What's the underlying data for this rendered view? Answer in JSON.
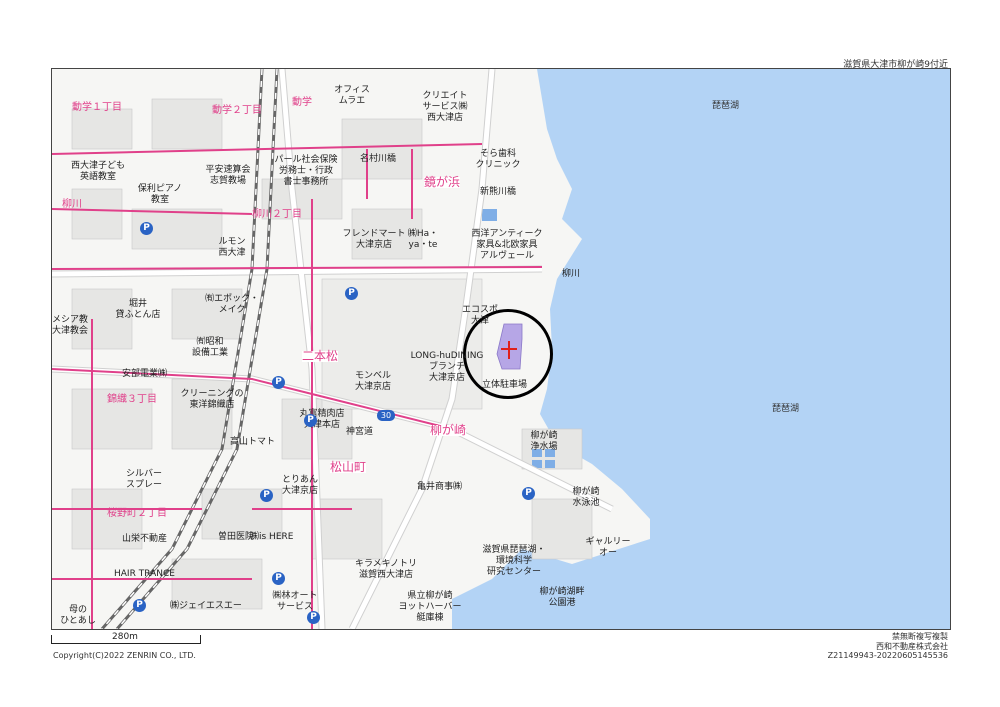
{
  "header": {
    "location": "滋賀県大津市柳が崎9付近"
  },
  "districts": {
    "d1": "動学１丁目",
    "d2": "動学２丁目",
    "d3": "動学",
    "d4": "鏡が浜",
    "d5": "柳川２丁目",
    "d6": "柳川",
    "d7": "二本松",
    "d8": "錦織３丁目",
    "d9": "柳が崎",
    "d10": "松山町",
    "d11": "桜野町２丁目"
  },
  "lake": {
    "name1": "琵琶湖",
    "name2": "琵琶湖"
  },
  "places": {
    "p1": "オフィス\nムラエ",
    "p2": "クリエイト\nサービス㈱\n西大津店",
    "p3": "名村川橋",
    "p4": "そら歯科\nクリニック",
    "p5": "新熊川橋",
    "p6": "西大津子ども\n英語教室",
    "p7": "平安速算会\n志賀教場",
    "p8": "パール社会保険\n労務士・行政\n書士事務所",
    "p9": "保利ピアノ\n教室",
    "p10": "フレンドマート\n大津京店",
    "p11": "㈱Ha・\nya・te",
    "p12": "西洋アンティーク\n家具&北欧家具\nアルヴェール",
    "p13": "ルモン\n西大津",
    "p14": "堀井\n貸ふとん店",
    "p15": "㈲エポック・\nメイク",
    "p16": "エコスポ\n大津",
    "p17": "メシア教\n大津教会",
    "p18": "㈲昭和\n設備工業",
    "p19": "LONG-huDINING\nブランチ\n大津京店",
    "p20": "安部電業㈱",
    "p21": "モンベル\n大津京店",
    "p22": "立体駐車場",
    "p23": "クリーニングの\n東洋錦織店",
    "p24": "丸富精肉店\n大津本店",
    "p25": "神宮道",
    "p26": "柳が崎\n浄水場",
    "p27": "高山トマト",
    "p28": "シルバー\nスプレー",
    "p29": "とりあん\n大津京店",
    "p30": "亀井商事㈱",
    "p31": "柳が崎\n水泳池",
    "p32": "山栄不動産",
    "p33": "曽田医院",
    "p34": "㈱is HERE",
    "p35": "滋賀県琵琶湖・\n環境科学\n研究センター",
    "p36": "ギャルリー\nオー",
    "p37": "HAIR TRANCE",
    "p38": "キラメキノトリ\n滋賀西大津店",
    "p39": "柳が崎湖畔\n公園港",
    "p40": "県立柳が崎\nヨットハーバー\n艇庫棟",
    "p41": "㈱林オート\nサービス",
    "p42": "㈱ジェイエスエー",
    "p43": "母の\nひとあし",
    "p44": "柳川"
  },
  "route": "30",
  "scale": {
    "label": "280m"
  },
  "footer": {
    "copyright": "Copyright(C)2022 ZENRIN CO., LTD.",
    "line1": "禁無断複写複製",
    "line2": "西和不動産株式会社",
    "line3": "Z21149943-20220605145536"
  },
  "colors": {
    "water": "#b3d3f5",
    "road_major": "#ffffff",
    "boundary": "#e0408a",
    "marker": "#e0201a"
  }
}
